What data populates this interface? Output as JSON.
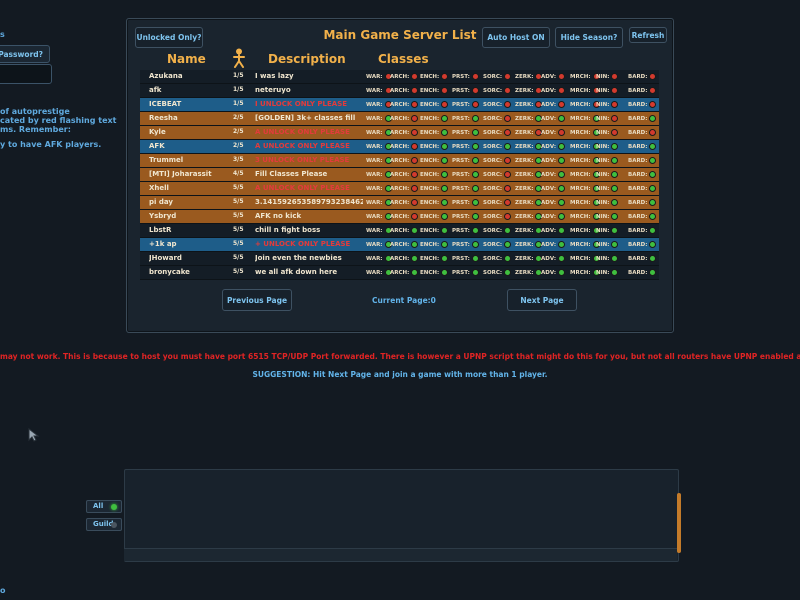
{
  "left_fragments": {
    "top_char": "s",
    "password_button": "Password?",
    "info_lines": [
      "of autoprestige",
      "cated by red flashing text",
      "ms. Remember:"
    ],
    "afk_line": "y to have AFK players.",
    "bottom_char": "o"
  },
  "panel": {
    "title": "Main Game Server List",
    "buttons": {
      "unlocked": "Unlocked Only?",
      "auto_host": "Auto Host ON",
      "hide_season": "Hide Season?",
      "refresh": "Refresh",
      "prev": "Previous Page",
      "next": "Next Page"
    },
    "headers": {
      "name": "Name",
      "description": "Description",
      "classes": "Classes"
    },
    "current_page_label": "Current Page:0",
    "class_labels": [
      "WAR:",
      "ARCH:",
      "ENCH:",
      "PRST:",
      "SORC:",
      "ZERK:",
      "ADV:",
      "MRCH:",
      "NIN:",
      "BARD:"
    ]
  },
  "servers": [
    {
      "name": "Azukana",
      "count": "1/5",
      "desc": "I was lazy",
      "desc_red": false,
      "style": "dark",
      "classes": [
        0,
        0,
        0,
        0,
        0,
        0,
        0,
        0,
        0,
        0
      ]
    },
    {
      "name": "afk",
      "count": "1/5",
      "desc": "neteruyo",
      "desc_red": false,
      "style": "dark",
      "classes": [
        0,
        0,
        0,
        0,
        0,
        0,
        0,
        0,
        0,
        0
      ]
    },
    {
      "name": "ICEBEAT",
      "count": "1/5",
      "desc": "I UNLOCK ONLY PLEASE",
      "desc_red": true,
      "style": "blue",
      "classes": [
        0,
        0,
        0,
        0,
        0,
        0,
        0,
        0,
        0,
        0
      ]
    },
    {
      "name": "Reesha",
      "count": "2/5",
      "desc": "[GOLDEN] 3k+ classes fill",
      "desc_red": false,
      "style": "orange",
      "classes": [
        1,
        0,
        1,
        1,
        0,
        1,
        1,
        1,
        0,
        1
      ]
    },
    {
      "name": "Kyle",
      "count": "2/5",
      "desc": "A UNLOCK ONLY PLEASE",
      "desc_red": true,
      "style": "orange",
      "classes": [
        1,
        0,
        1,
        1,
        0,
        0,
        0,
        1,
        0,
        0
      ]
    },
    {
      "name": "AFK",
      "count": "2/5",
      "desc": "A UNLOCK ONLY PLEASE",
      "desc_red": true,
      "style": "blue",
      "classes": [
        1,
        0,
        1,
        1,
        1,
        1,
        1,
        1,
        1,
        1
      ]
    },
    {
      "name": "Trummel",
      "count": "3/5",
      "desc": "3 UNLOCK ONLY PLEASE",
      "desc_red": true,
      "style": "orange",
      "classes": [
        1,
        0,
        1,
        1,
        0,
        1,
        1,
        1,
        1,
        1
      ]
    },
    {
      "name": "[MTI] Joharassit",
      "count": "4/5",
      "desc": "Fill Classes Please",
      "desc_red": false,
      "style": "orange",
      "classes": [
        1,
        0,
        1,
        1,
        0,
        1,
        1,
        1,
        1,
        1
      ]
    },
    {
      "name": "Xhell",
      "count": "5/5",
      "desc": "A UNLOCK ONLY PLEASE",
      "desc_red": true,
      "style": "orange",
      "classes": [
        1,
        0,
        1,
        1,
        0,
        1,
        1,
        1,
        1,
        1
      ]
    },
    {
      "name": "pi day",
      "count": "5/5",
      "desc": "3.14159265358979323846264",
      "desc_red": false,
      "style": "orange",
      "classes": [
        1,
        0,
        1,
        1,
        0,
        1,
        1,
        1,
        1,
        1
      ]
    },
    {
      "name": "Ysbryd",
      "count": "5/5",
      "desc": "AFK no kick",
      "desc_red": false,
      "style": "orange",
      "classes": [
        1,
        0,
        1,
        1,
        0,
        1,
        1,
        1,
        1,
        1
      ]
    },
    {
      "name": "LbstR",
      "count": "5/5",
      "desc": "chill n fight boss",
      "desc_red": false,
      "style": "dark",
      "classes": [
        1,
        1,
        1,
        1,
        1,
        1,
        1,
        1,
        1,
        1
      ]
    },
    {
      "name": "+1k ap",
      "count": "5/5",
      "desc": "+ UNLOCK ONLY PLEASE",
      "desc_red": true,
      "style": "blue",
      "classes": [
        1,
        1,
        1,
        1,
        1,
        1,
        1,
        1,
        1,
        1
      ]
    },
    {
      "name": "JHoward",
      "count": "5/5",
      "desc": "Join even the newbies",
      "desc_red": false,
      "style": "dark",
      "classes": [
        1,
        1,
        1,
        1,
        1,
        1,
        1,
        1,
        1,
        1
      ]
    },
    {
      "name": "bronycake",
      "count": "5/5",
      "desc": "we all afk down here",
      "desc_red": false,
      "style": "dark",
      "classes": [
        1,
        1,
        1,
        1,
        1,
        1,
        1,
        1,
        1,
        1
      ]
    }
  ],
  "warning": "may not work. This is because to host you must have port 6515 TCP/UDP Port forwarded. There is however a UPNP script that might do this for you, but not all routers have UPNP enabled and most AV/Anti Malware pr",
  "suggestion": "SUGGESTION: Hit Next Page and join a game with more than 1 player.",
  "chat": {
    "tabs": [
      {
        "label": "All",
        "indicator": "#3fbf3f"
      },
      {
        "label": "Guild",
        "indicator": "#4a5560"
      }
    ]
  },
  "colors": {
    "accent_orange": "#f2b14a",
    "row_orange": "#9a5a1f",
    "row_blue": "#1e5d89",
    "text_blue": "#62b4ea",
    "warn_red": "#e02424"
  },
  "icons": {
    "player_count_icon": "stick-figure-icon",
    "cursor": "mouse-cursor-icon"
  }
}
